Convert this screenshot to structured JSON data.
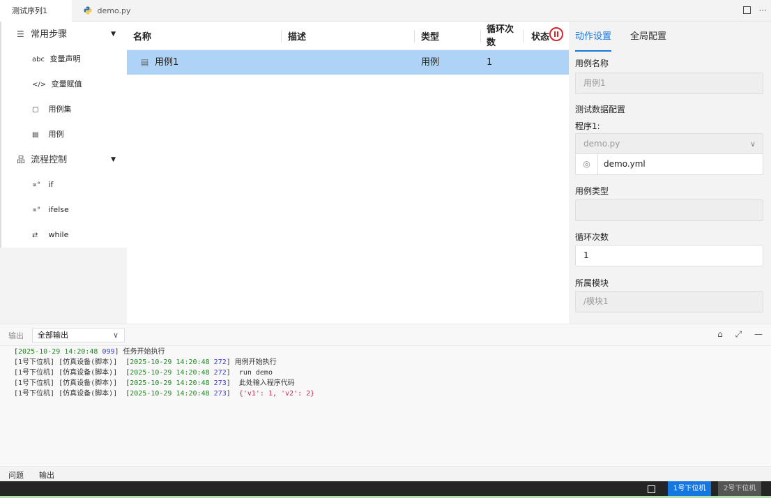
{
  "tabs": [
    {
      "label": "测试序列1",
      "active": true
    },
    {
      "label": "demo.py",
      "active": false
    }
  ],
  "tab_actions": {
    "more": "···"
  },
  "sidebar": {
    "groups": [
      {
        "label": "常用步骤",
        "icon": "list-icon",
        "items": [
          {
            "icon_text": "abc",
            "label": "变量声明"
          },
          {
            "icon_text": "</>",
            "label": "变量赋值"
          },
          {
            "icon_text": "▢",
            "label": "用例集"
          },
          {
            "icon_text": "▤",
            "label": "用例"
          }
        ]
      },
      {
        "label": "流程控制",
        "icon": "hierarchy-icon",
        "items": [
          {
            "icon_text": "∝°",
            "label": "if"
          },
          {
            "icon_text": "∝°",
            "label": "ifelse"
          },
          {
            "icon_text": "⇄",
            "label": "while"
          }
        ]
      }
    ]
  },
  "table": {
    "columns": [
      "名称",
      "描述",
      "类型",
      "循环次数",
      "状态"
    ],
    "rows": [
      {
        "name": "用例1",
        "desc": "",
        "type": "用例",
        "loops": "1",
        "status": ""
      }
    ]
  },
  "right_panel": {
    "tabs": [
      "动作设置",
      "全局配置"
    ],
    "case_name_label": "用例名称",
    "case_name_placeholder": "用例1",
    "test_data_label": "测试数据配置",
    "program_label": "程序1:",
    "program_select": "demo.py",
    "data_file": "demo.yml",
    "case_type_label": "用例类型",
    "case_type_value": "",
    "loop_label": "循环次数",
    "loop_value": "1",
    "module_label": "所属模块",
    "module_value": "/模块1"
  },
  "output": {
    "label": "输出",
    "select_value": "全部输出",
    "logs": [
      {
        "prefix": "",
        "date": "2025-10-29 14:20:48",
        "ms": "099",
        "msg": "任务开始执行"
      },
      {
        "prefix": "[1号下位机] [仿真设备(脚本)]  ",
        "date": "2025-10-29 14:20:48",
        "ms": "272",
        "msg": "用例开始执行"
      },
      {
        "prefix": "[1号下位机] [仿真设备(脚本)]  ",
        "date": "2025-10-29 14:20:48",
        "ms": "272",
        "msg": " run demo"
      },
      {
        "prefix": "[1号下位机] [仿真设备(脚本)]  ",
        "date": "2025-10-29 14:20:48",
        "ms": "273",
        "msg": " 此处输入程序代码"
      },
      {
        "prefix": "[1号下位机] [仿真设备(脚本)]  ",
        "date": "2025-10-29 14:20:48",
        "ms": "273",
        "msg": " {'v1': 1, 'v2': 2}"
      }
    ]
  },
  "bottom_tabs": [
    {
      "label": "问题",
      "active": false
    },
    {
      "label": "输出",
      "active": true
    }
  ],
  "status_bar": {
    "devices": [
      "1号下位机",
      "2号下位机"
    ]
  },
  "colors": {
    "accent": "#1677e0",
    "selected_row": "#aed3f7",
    "pause": "#d9252a"
  }
}
